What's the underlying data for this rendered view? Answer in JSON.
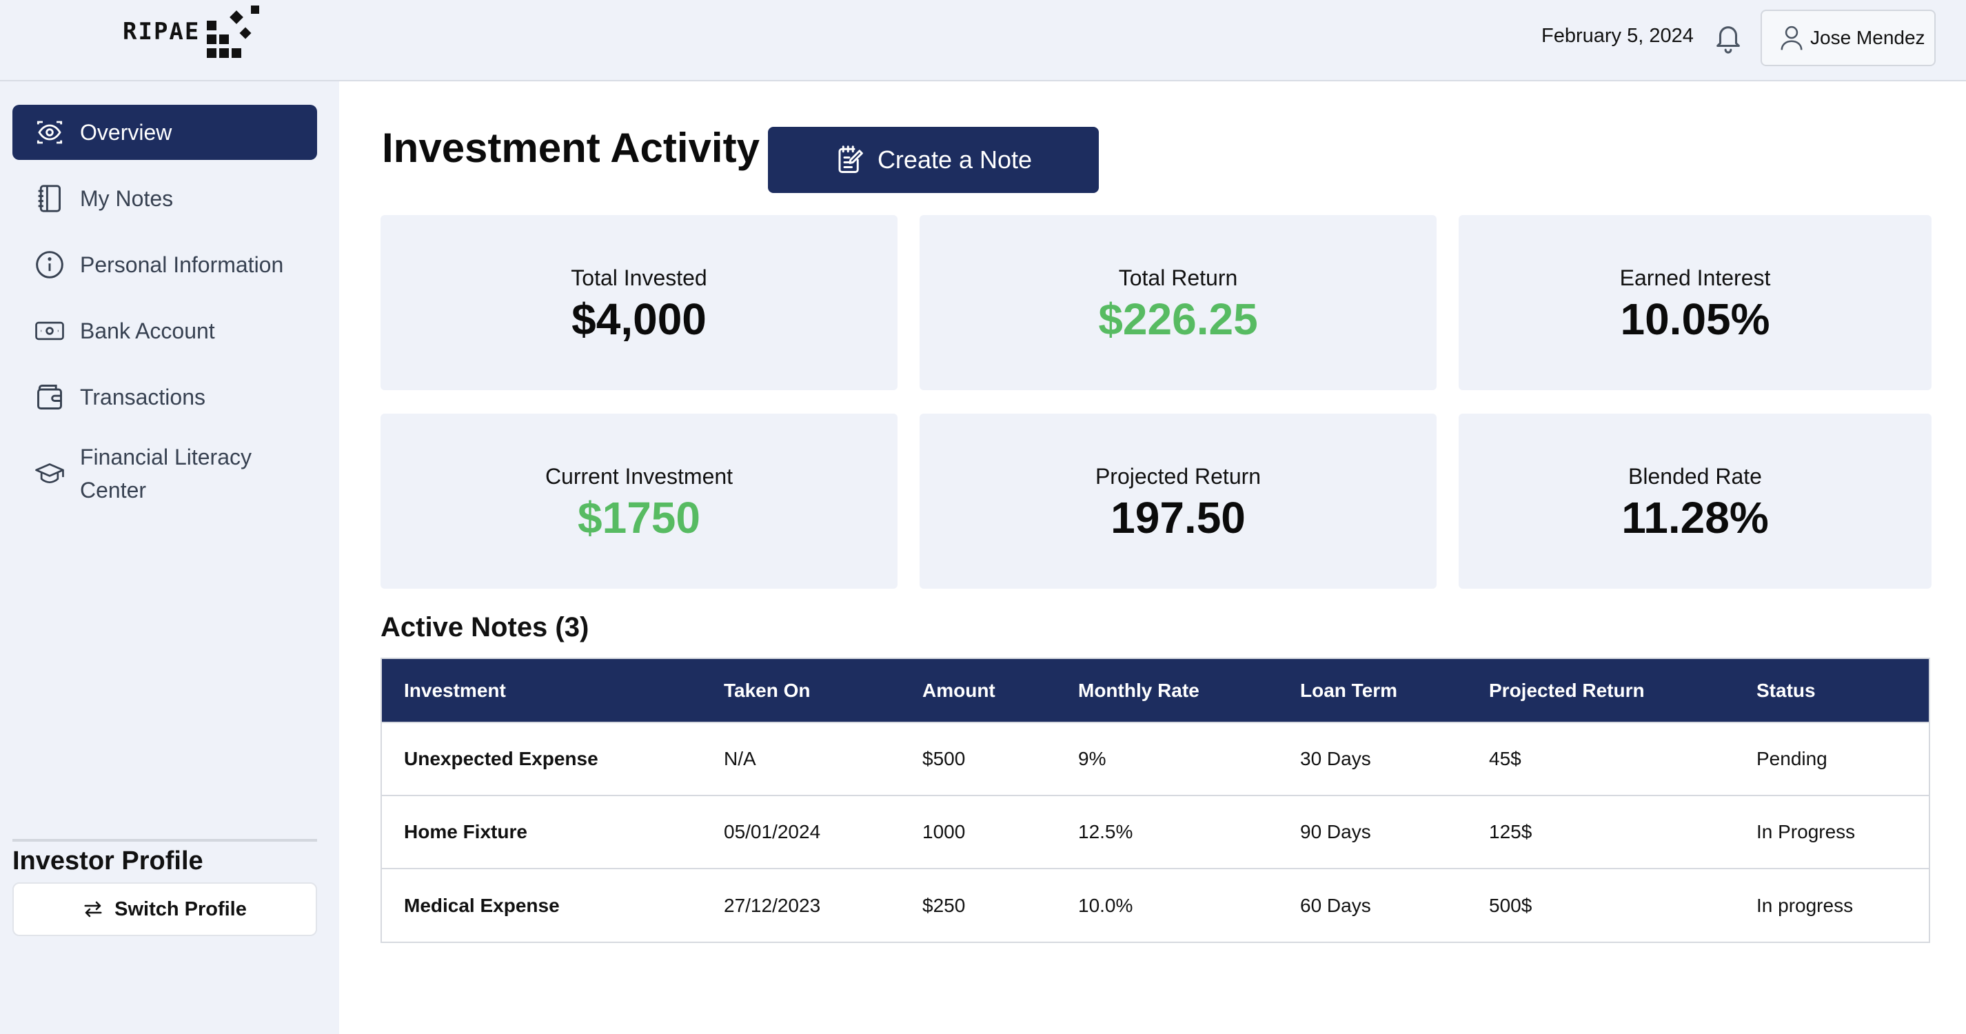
{
  "header": {
    "logo_text": "RIPAE",
    "date": "February 5, 2024",
    "user_name": "Jose Mendez"
  },
  "sidebar": {
    "items": [
      {
        "label": "Overview",
        "icon": "eye-icon",
        "active": true
      },
      {
        "label": "My Notes",
        "icon": "notebook-icon",
        "active": false
      },
      {
        "label": "Personal Information",
        "icon": "info-circle-icon",
        "active": false
      },
      {
        "label": "Bank Account",
        "icon": "cash-icon",
        "active": false
      },
      {
        "label": "Transactions",
        "icon": "wallet-icon",
        "active": false
      },
      {
        "label": "Financial Literacy Center",
        "icon": "graduation-cap-icon",
        "active": false
      }
    ],
    "profile_title": "Investor Profile",
    "switch_profile_label": "Switch Profile"
  },
  "main": {
    "title": "Investment Activity",
    "create_note_label": "Create a Note",
    "stats": [
      {
        "label": "Total Invested",
        "value": "$4,000",
        "highlight": false
      },
      {
        "label": "Total Return",
        "value": "$226.25",
        "highlight": true
      },
      {
        "label": "Earned Interest",
        "value": "10.05%",
        "highlight": false
      },
      {
        "label": "Current Investment",
        "value": "$1750",
        "highlight": true
      },
      {
        "label": "Projected Return",
        "value": "197.50",
        "highlight": false
      },
      {
        "label": "Blended Rate",
        "value": "11.28%",
        "highlight": false
      }
    ],
    "notes_title": "Active Notes (3)",
    "table": {
      "columns": [
        "Investment",
        "Taken On",
        "Amount",
        "Monthly Rate",
        "Loan Term",
        "Projected Return",
        "Status"
      ],
      "rows": [
        [
          "Unexpected Expense",
          "N/A",
          "$500",
          "9%",
          "30 Days",
          "45$",
          "Pending"
        ],
        [
          "Home Fixture",
          "05/01/2024",
          "1000",
          "12.5%",
          "90 Days",
          "125$",
          "In Progress"
        ],
        [
          "Medical Expense",
          "27/12/2023",
          "$250",
          "10.0%",
          "60 Days",
          "500$",
          "In progress"
        ]
      ]
    }
  },
  "colors": {
    "navy": "#1d2d5f",
    "panel": "#eff2f9",
    "green": "#57bb62"
  }
}
